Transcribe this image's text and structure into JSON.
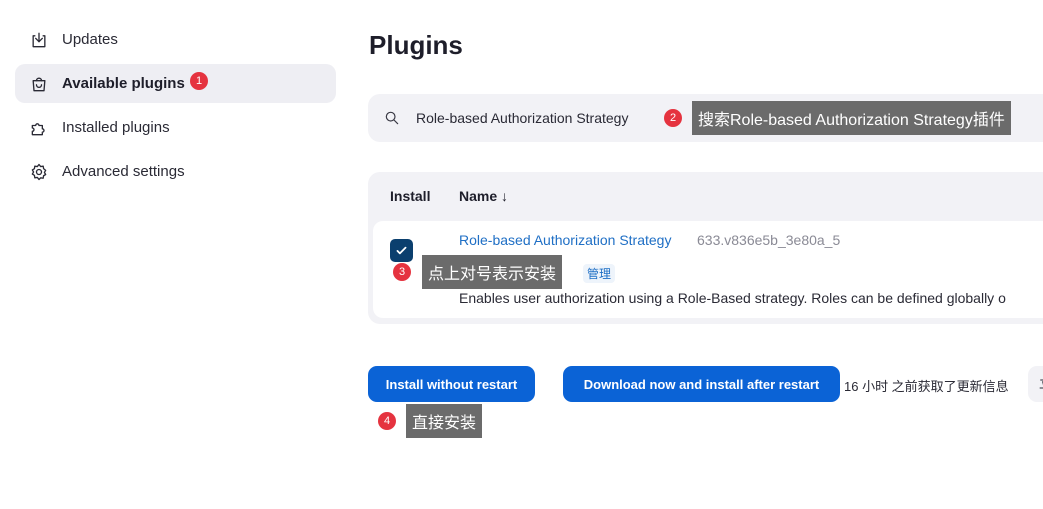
{
  "sidebar": {
    "items": [
      {
        "label": "Updates",
        "icon": "download-icon"
      },
      {
        "label": "Available plugins",
        "icon": "shopping-bag-icon",
        "badge": "1"
      },
      {
        "label": "Installed plugins",
        "icon": "puzzle-icon"
      },
      {
        "label": "Advanced settings",
        "icon": "gear-icon"
      }
    ]
  },
  "main": {
    "title": "Plugins",
    "search": {
      "value": "Role-based Authorization Strategy"
    },
    "table": {
      "headers": {
        "install": "Install",
        "name": "Name ↓"
      },
      "rows": [
        {
          "checked": true,
          "name": "Role-based Authorization Strategy",
          "version": "633.v836e5b_3e80a_5",
          "tag": "管理",
          "description": "Enables user authorization using a Role-Based strategy. Roles can be defined globally o"
        }
      ]
    },
    "buttons": {
      "install_without_restart": "Install without restart",
      "download_and_install": "Download now and install after restart"
    },
    "update_info": "16 小时 之前获取了更新信息",
    "chip_text": "立"
  },
  "annotations": [
    {
      "num": "2",
      "text": "搜索Role-based Authorization Strategy插件"
    },
    {
      "num": "3",
      "text": "点上对号表示安装"
    },
    {
      "num": "4",
      "text": "直接安装"
    }
  ],
  "colors": {
    "primary_button": "#0b63d6",
    "link": "#1f6fc5",
    "badge": "#e5333f",
    "checkbox": "#0b3f6e"
  }
}
